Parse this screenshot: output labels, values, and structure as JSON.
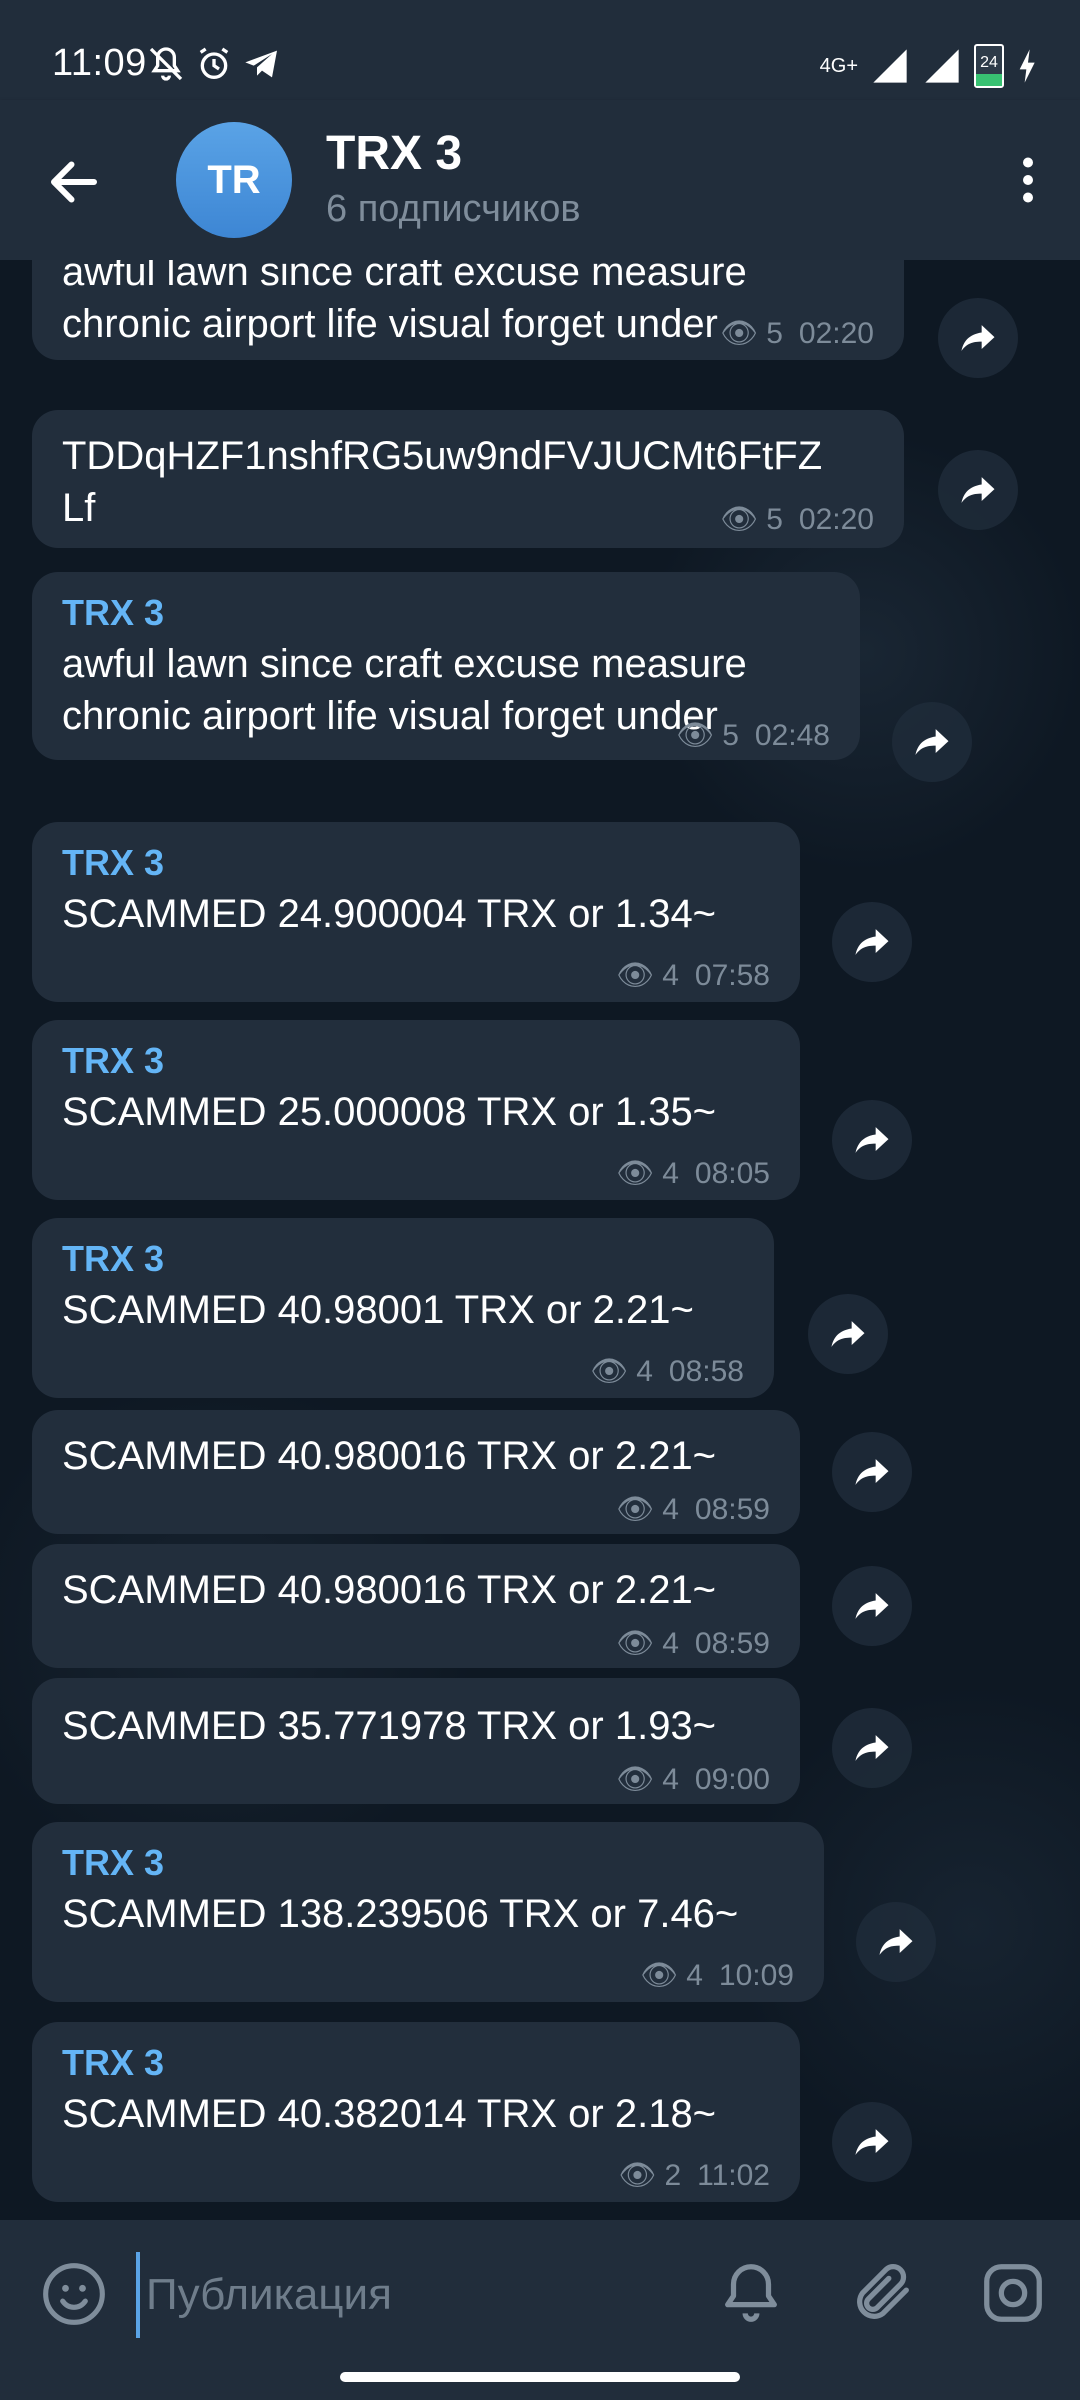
{
  "status_bar": {
    "time": "11:09",
    "network": "4G+",
    "battery": "24",
    "icons": [
      "mute-icon",
      "alarm-icon",
      "telegram-icon",
      "signal-icon",
      "battery-icon",
      "charging-icon"
    ]
  },
  "header": {
    "avatar_initials": "TR",
    "title": "TRX 3",
    "subtitle": "6 подписчиков",
    "avatar_color": "#4a94dd"
  },
  "messages": [
    {
      "sender": "",
      "text": "awful lawn since craft excuse measure\nchronic airport life visual forget under",
      "views": "5",
      "time": "02:20"
    },
    {
      "sender": "",
      "text": "TDDqHZF1nshfRG5uw9ndFVJUCMt6FtFZ\nLf",
      "views": "5",
      "time": "02:20"
    },
    {
      "sender": "TRX 3",
      "text": "awful lawn since craft excuse measure\nchronic airport life visual forget under",
      "views": "5",
      "time": "02:48"
    },
    {
      "sender": "TRX 3",
      "text": "SCAMMED 24.900004 TRX or 1.34~",
      "views": "4",
      "time": "07:58"
    },
    {
      "sender": "TRX 3",
      "text": "SCAMMED 25.000008 TRX or 1.35~",
      "views": "4",
      "time": "08:05"
    },
    {
      "sender": "TRX 3",
      "text": "SCAMMED 40.98001 TRX or 2.21~",
      "views": "4",
      "time": "08:58"
    },
    {
      "sender": "",
      "text": "SCAMMED 40.980016 TRX or 2.21~",
      "views": "4",
      "time": "08:59"
    },
    {
      "sender": "",
      "text": "SCAMMED 40.980016 TRX or 2.21~",
      "views": "4",
      "time": "08:59"
    },
    {
      "sender": "",
      "text": "SCAMMED 35.771978 TRX or 1.93~",
      "views": "4",
      "time": "09:00"
    },
    {
      "sender": "TRX 3",
      "text": "SCAMMED 138.239506 TRX or 7.46~",
      "views": "4",
      "time": "10:09"
    },
    {
      "sender": "TRX 3",
      "text": "SCAMMED 40.382014 TRX or 2.18~",
      "views": "2",
      "time": "11:02"
    }
  ],
  "input": {
    "placeholder": "Публикация",
    "value": ""
  },
  "colors": {
    "accent": "#64b5f6",
    "bubble": "#222e3c",
    "header": "#212d3b",
    "meta": "#7d8b99"
  }
}
